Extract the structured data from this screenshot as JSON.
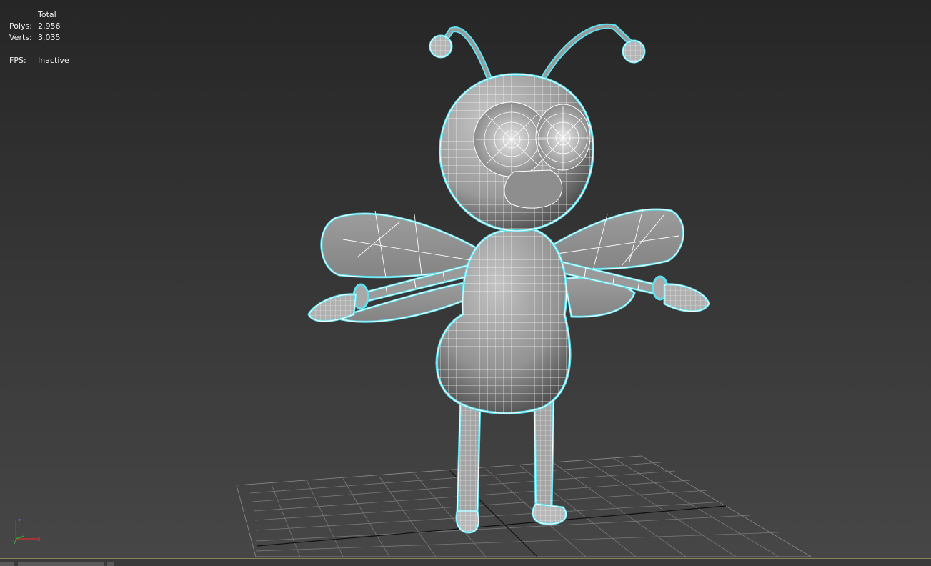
{
  "viewport": {
    "name": "perspective-viewport",
    "selection_color": "#5fe0ee"
  },
  "stats": {
    "header": "Total",
    "polys_label": "Polys:",
    "polys_value": "2,956",
    "verts_label": "Verts:",
    "verts_value": "3,035",
    "fps_label": "FPS:",
    "fps_value": "Inactive"
  },
  "axis_gizmo": {
    "z_label": "z",
    "x_label": "x",
    "y_label": "y",
    "x_color": "#c03030",
    "y_color": "#30a030",
    "z_color": "#3050d0"
  },
  "model": {
    "icon": "bee-character-wireframe"
  }
}
